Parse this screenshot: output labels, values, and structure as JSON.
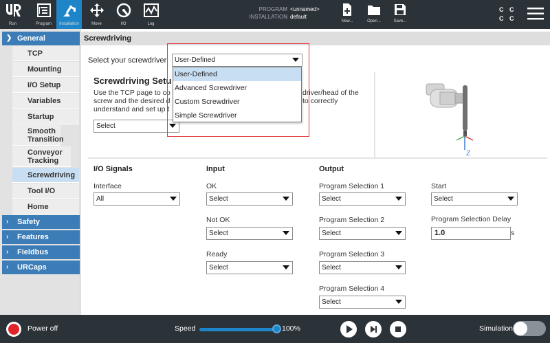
{
  "topbar": {
    "nav": [
      {
        "label": "Run",
        "icon": "ur-logo-icon"
      },
      {
        "label": "Program",
        "icon": "program-icon"
      },
      {
        "label": "Installation",
        "icon": "installation-icon",
        "active": true
      },
      {
        "label": "Move",
        "icon": "move-icon"
      },
      {
        "label": "I/O",
        "icon": "io-icon"
      },
      {
        "label": "Log",
        "icon": "log-icon"
      }
    ],
    "program_key": "PROGRAM",
    "program_value": "<unnamed>",
    "installation_key": "INSTALLATION",
    "installation_value": "default",
    "file_buttons": [
      {
        "label": "New...",
        "icon": "new-file-icon"
      },
      {
        "label": "Open...",
        "icon": "open-folder-icon"
      },
      {
        "label": "Save...",
        "icon": "save-icon"
      }
    ],
    "cc_top": "C C",
    "cc_bottom": "C C",
    "accent": "#1e85c8"
  },
  "sidebar": {
    "groups": [
      {
        "label": "General",
        "expanded": true
      },
      {
        "label": "Safety"
      },
      {
        "label": "Features"
      },
      {
        "label": "Fieldbus"
      },
      {
        "label": "URCaps"
      }
    ],
    "items": [
      {
        "label": "TCP"
      },
      {
        "label": "Mounting"
      },
      {
        "label": "I/O Setup"
      },
      {
        "label": "Variables"
      },
      {
        "label": "Startup"
      },
      {
        "label": "Smooth Transition"
      },
      {
        "label": "Conveyor Tracking"
      },
      {
        "label": "Screwdriving",
        "selected": true
      },
      {
        "label": "Tool I/O"
      },
      {
        "label": "Home"
      }
    ]
  },
  "main": {
    "title": "Screwdriving",
    "select_label": "Select your screwdriver",
    "screwdriver_select": {
      "value": "User-Defined",
      "options": [
        "User-Defined",
        "Advanced Screwdriver",
        "Custom Screwdriver",
        "Simple Screwdriver"
      ]
    },
    "setup_title": "Screwdriving Setu",
    "setup_desc_left": "Use the TCP page to co",
    "setup_desc_right": "driver/head of the",
    "setup_desc_2_left": "screw and the desired d",
    "setup_desc_2_right": "to correctly",
    "setup_desc_3": "understand and set up t",
    "tcp_select_value": "Select",
    "io_signals_title": "I/O Signals",
    "interface_label": "Interface",
    "interface_value": "All",
    "input_title": "Input",
    "inputs": [
      {
        "label": "OK",
        "value": "Select"
      },
      {
        "label": "Not OK",
        "value": "Select"
      },
      {
        "label": "Ready",
        "value": "Select"
      }
    ],
    "output_title": "Output",
    "outputs": [
      {
        "label": "Program Selection 1",
        "value": "Select"
      },
      {
        "label": "Program Selection 2",
        "value": "Select"
      },
      {
        "label": "Program Selection 3",
        "value": "Select"
      },
      {
        "label": "Program Selection 4",
        "value": "Select"
      }
    ],
    "start_label": "Start",
    "start_value": "Select",
    "delay_label": "Program Selection Delay",
    "delay_value": "1.0",
    "delay_unit": "s",
    "axis_label": "Z"
  },
  "bottombar": {
    "power_label": "Power off",
    "speed_label": "Speed",
    "speed_percent": 100,
    "speed_text": "100%",
    "simulation_label": "Simulation",
    "simulation_on": false
  }
}
